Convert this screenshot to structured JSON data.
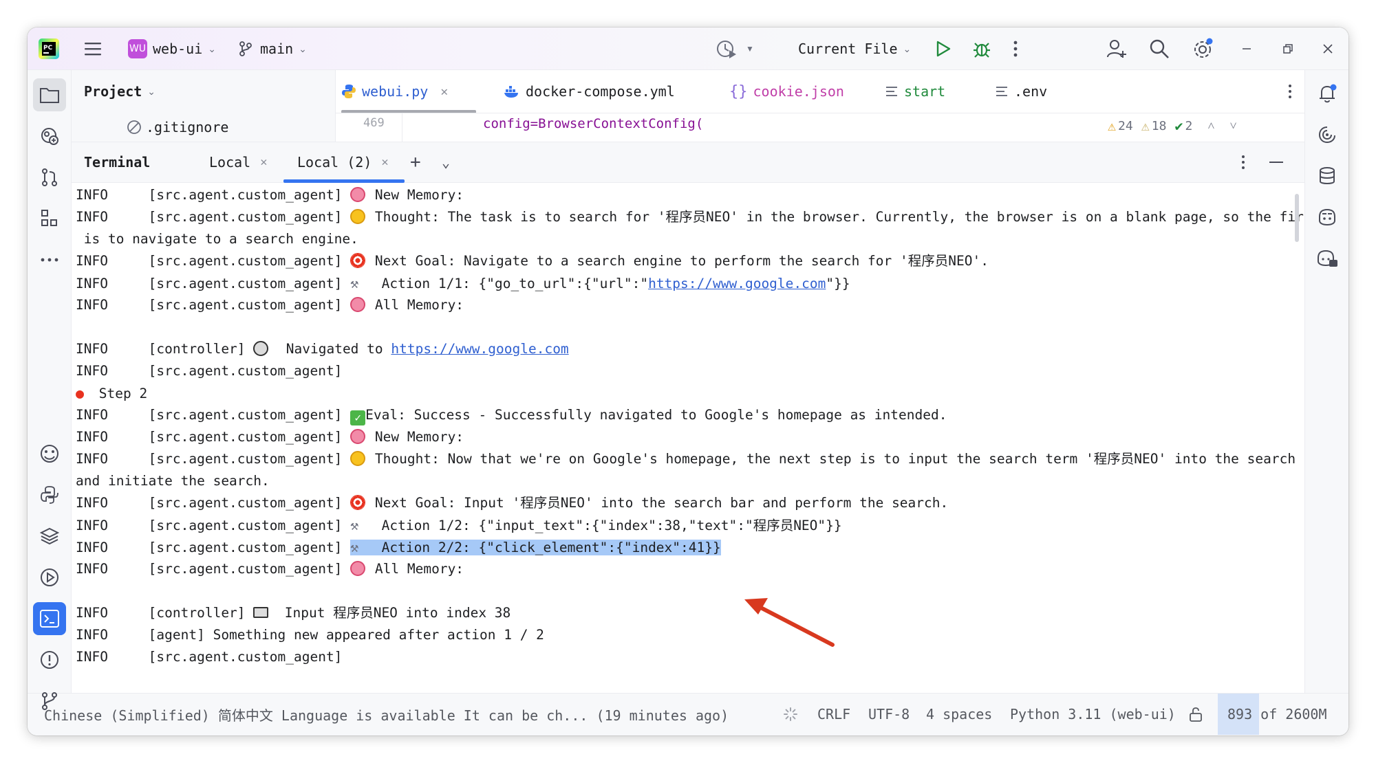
{
  "titlebar": {
    "project_badge": "WU",
    "project_name": "web-ui",
    "branch": "main",
    "run_config": "Current File"
  },
  "project_panel": {
    "title": "Project",
    "file": ".gitignore"
  },
  "editor": {
    "tabs": [
      {
        "label": "webui.py",
        "active": true
      },
      {
        "label": "docker-compose.yml"
      },
      {
        "label": "cookie.json"
      },
      {
        "label": "start"
      },
      {
        "label": ".env"
      }
    ],
    "line_number": "469",
    "code_line": "config=BrowserContextConfig(",
    "inspections": {
      "warnings": "24",
      "weak_warnings": "18",
      "ok": "2"
    }
  },
  "terminal": {
    "title": "Terminal",
    "tabs": [
      {
        "label": "Local"
      },
      {
        "label": "Local (2)",
        "active": true
      }
    ],
    "lines": {
      "l1": "INFO     [src.agent.custom_agent] ",
      "l1b": " New Memory:",
      "l2": "INFO     [src.agent.custom_agent] ",
      "l2b": " Thought: The task is to search for '程序员NEO' in the browser. Currently, the browser is on a blank page, so the first s",
      "l3": " is to navigate to a search engine.",
      "l4": "INFO     [src.agent.custom_agent] ",
      "l4b": " Next Goal: Navigate to a search engine to perform the search for '程序员NEO'.",
      "l5": "INFO     [src.agent.custom_agent] ",
      "l5b": "  Action 1/1: {\"go_to_url\":{\"url\":\"",
      "l5link": "https://www.google.com",
      "l5c": "\"}}",
      "l6": "INFO     [src.agent.custom_agent] ",
      "l6b": " All Memory:",
      "l7": "INFO     [controller] ",
      "l7b": "  Navigated to ",
      "l7link": "https://www.google.com",
      "l8": "INFO     [src.agent.custom_agent]",
      "l9": " Step 2",
      "l10": "INFO     [src.agent.custom_agent] ",
      "l10b": "Eval: Success - Successfully navigated to Google's homepage as intended.",
      "l11": "INFO     [src.agent.custom_agent] ",
      "l11b": " New Memory:",
      "l12": "INFO     [src.agent.custom_agent] ",
      "l12b": " Thought: Now that we're on Google's homepage, the next step is to input the search term '程序员NEO' into the search bar",
      "l13": "and initiate the search.",
      "l14": "INFO     [src.agent.custom_agent] ",
      "l14b": " Next Goal: Input '程序员NEO' into the search bar and perform the search.",
      "l15": "INFO     [src.agent.custom_agent] ",
      "l15b": "  Action 1/2: {\"input_text\":{\"index\":38,\"text\":\"程序员NEO\"}}",
      "l16": "INFO     [src.agent.custom_agent] ",
      "l16b": "  Action 2/2: {\"click_element\":{\"index\":41}}",
      "l17": "INFO     [src.agent.custom_agent] ",
      "l17b": " All Memory:",
      "l18": "INFO     [controller] ",
      "l18b": "  Input 程序员NEO into index 38",
      "l19": "INFO     [agent] Something new appeared after action 1 / 2",
      "l20": "INFO     [src.agent.custom_agent]"
    }
  },
  "statusbar": {
    "message": "Chinese (Simplified) 简体中文 Language is available It can be ch... (19 minutes ago)",
    "line_sep": "CRLF",
    "encoding": "UTF-8",
    "indent": "4 spaces",
    "interpreter": "Python 3.11 (web-ui)",
    "memory": "893 of 2600M"
  },
  "colors": {
    "accent": "#3574f0",
    "run_green": "#208a3c",
    "annotation_arrow": "#d8391f",
    "selection": "#a6c9f7"
  }
}
